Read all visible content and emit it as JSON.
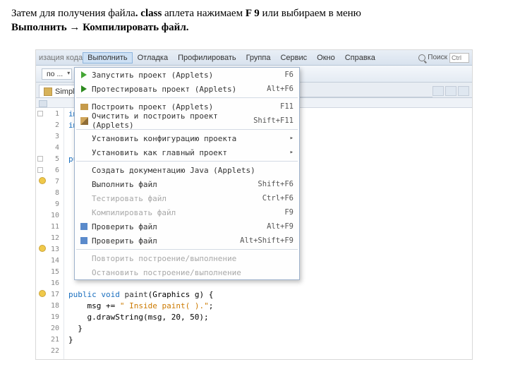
{
  "caption_parts": {
    "p1": "Затем для получения файла",
    "p2": ". class",
    "p3": " аплета нажимаем ",
    "p4": "F 9",
    "p5": " или выбираем в меню ",
    "p6": "Выполнить → Компилировать файл."
  },
  "menubar": {
    "trunc": "изация кода",
    "items": [
      "Выполнить",
      "Отладка",
      "Профилировать",
      "Группа",
      "Сервис",
      "Окно",
      "Справка"
    ],
    "search_label": "Поиск",
    "search_shortcut": "Ctrl"
  },
  "toolbar": {
    "config": "по ...",
    "build": "▾"
  },
  "tab": {
    "filename": "SimpleApplet"
  },
  "gutter_lines": [
    "1",
    "2",
    "3",
    "4",
    "5",
    "6",
    "7",
    "8",
    "9",
    "10",
    "11",
    "12",
    "13",
    "14",
    "15",
    "16",
    "17",
    "18",
    "19",
    "20",
    "21",
    "22"
  ],
  "code_visible": {
    "l1_kw": "im",
    "l2_kw": "im",
    "l5_kw": "pu",
    "l17_kw": "public void ",
    "l17_fn": "paint",
    "l17_rest": "(Graphics g) {",
    "l18_a": "    msg += ",
    "l18_str": "\" Inside paint( ).\"",
    "l18_b": ";",
    "l19": "    g.drawString(msg, 20, 50);",
    "l20": "  }",
    "l21": "}"
  },
  "menu": [
    {
      "icon": "tri-green",
      "label": "Запустить проект (Applets)",
      "shortcut": "F6"
    },
    {
      "icon": "tri-green2",
      "label": "Протестировать проект (Applets)",
      "shortcut": "Alt+F6"
    },
    {
      "sep": true
    },
    {
      "icon": "hammer",
      "label": "Построить проект (Applets)",
      "shortcut": "F11"
    },
    {
      "icon": "broom",
      "label": "Очистить и построить проект (Applets)",
      "shortcut": "Shift+F11"
    },
    {
      "sep": true
    },
    {
      "label": "Установить конфигурацию проекта",
      "submenu": true
    },
    {
      "label": "Установить как главный проект",
      "submenu": true
    },
    {
      "sep": true
    },
    {
      "label": "Создать документацию Java (Applets)"
    },
    {
      "label": "Выполнить файл",
      "shortcut": "Shift+F6"
    },
    {
      "label": "Тестировать файл",
      "shortcut": "Ctrl+F6",
      "disabled": true
    },
    {
      "label": "Компилировать файл",
      "shortcut": "F9",
      "disabled": true
    },
    {
      "icon": "sq-blue",
      "label": "Проверить файл",
      "shortcut": "Alt+F9"
    },
    {
      "icon": "sq-blue",
      "label": "Проверить файл",
      "shortcut": "Alt+Shift+F9"
    },
    {
      "sep": true
    },
    {
      "label": "Повторить построение/выполнение",
      "disabled": true
    },
    {
      "label": "Остановить построение/выполнение",
      "disabled": true
    }
  ]
}
